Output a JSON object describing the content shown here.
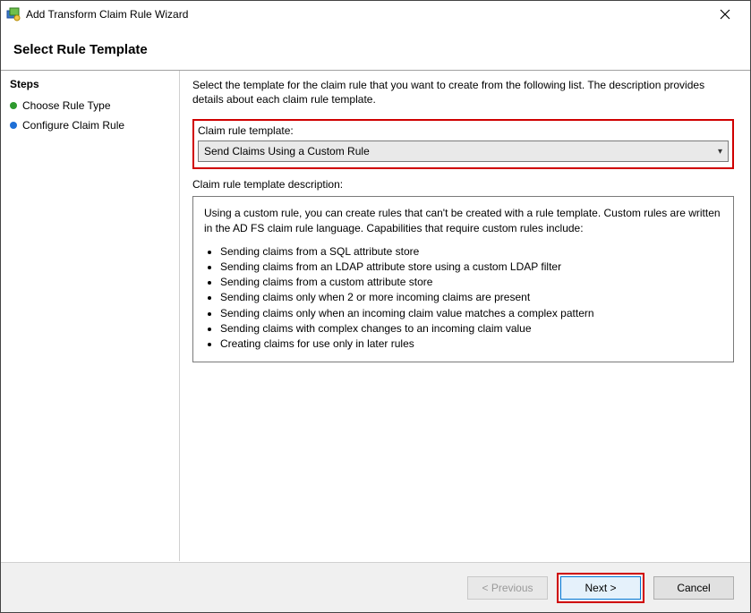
{
  "window": {
    "title": "Add Transform Claim Rule Wizard"
  },
  "header": {
    "heading": "Select Rule Template"
  },
  "sidebar": {
    "stepsLabel": "Steps",
    "step1": "Choose Rule Type",
    "step2": "Configure Claim Rule"
  },
  "content": {
    "intro": "Select the template for the claim rule that you want to create from the following list. The description provides details about each claim rule template.",
    "templateLabel": "Claim rule template:",
    "templateValue": "Send Claims Using a Custom Rule",
    "descLabel": "Claim rule template description:",
    "descIntro": "Using a custom rule, you can create rules that can't be created with a rule template.  Custom rules are written in the AD FS claim rule language.  Capabilities that require custom rules include:",
    "b1": "Sending claims from a SQL attribute store",
    "b2": "Sending claims from an LDAP attribute store using a custom LDAP filter",
    "b3": "Sending claims from a custom attribute store",
    "b4": "Sending claims only when 2 or more incoming claims are present",
    "b5": "Sending claims only when an incoming claim value matches a complex pattern",
    "b6": "Sending claims with complex changes to an incoming claim value",
    "b7": "Creating claims for use only in later rules"
  },
  "footer": {
    "prev": "< Previous",
    "next": "Next >",
    "cancel": "Cancel"
  }
}
